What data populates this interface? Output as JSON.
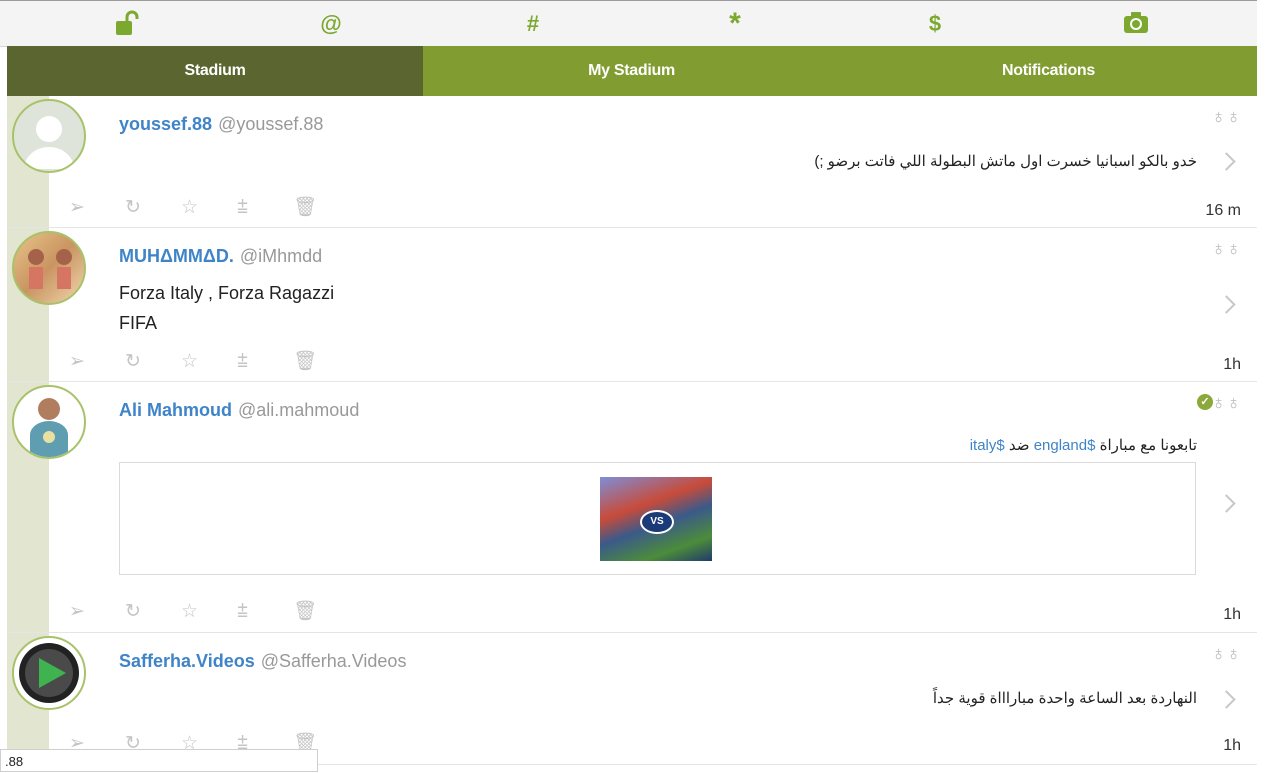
{
  "toolbar": {
    "icons": [
      "unlock-icon",
      "at-icon",
      "hash-icon",
      "asterisk-icon",
      "dollar-icon",
      "camera-icon"
    ],
    "at_glyph": "@",
    "hash_glyph": "#",
    "asterisk_glyph": "*",
    "dollar_glyph": "$"
  },
  "tabs": [
    {
      "label": "Stadium",
      "active": true
    },
    {
      "label": "My Stadium",
      "active": false
    },
    {
      "label": "Notifications",
      "active": false
    }
  ],
  "colors": {
    "accent": "#819c31",
    "active_tab": "#5b6530",
    "link": "#3f84c8"
  },
  "posts": [
    {
      "name": "youssef.88",
      "handle": "@youssef.88",
      "text": "خدو بالكو اسبانيا خسرت اول ماتش البطولة اللي فاتت برضو ;)",
      "time": "16 m"
    },
    {
      "name": "MUHΔMMΔD.",
      "handle": "@iMhmdd",
      "text_line1": "Forza Italy , Forza Ragazzi",
      "text_line2": "FIFA",
      "time": "1h"
    },
    {
      "name": "Ali Mahmoud",
      "handle": "@ali.mahmoud",
      "text_prefix": "تابعونا مع مباراة",
      "tag1": "$england",
      "text_mid": "ضد",
      "tag2": "$italy",
      "time": "1h",
      "verified": true
    },
    {
      "name": "Safferha.Videos",
      "handle": "@Safferha.Videos",
      "text": "النهاردة بعد الساعة واحدة مباراااة قوية جداً",
      "time": "1h"
    }
  ],
  "status_bar": {
    "text": ".88"
  }
}
